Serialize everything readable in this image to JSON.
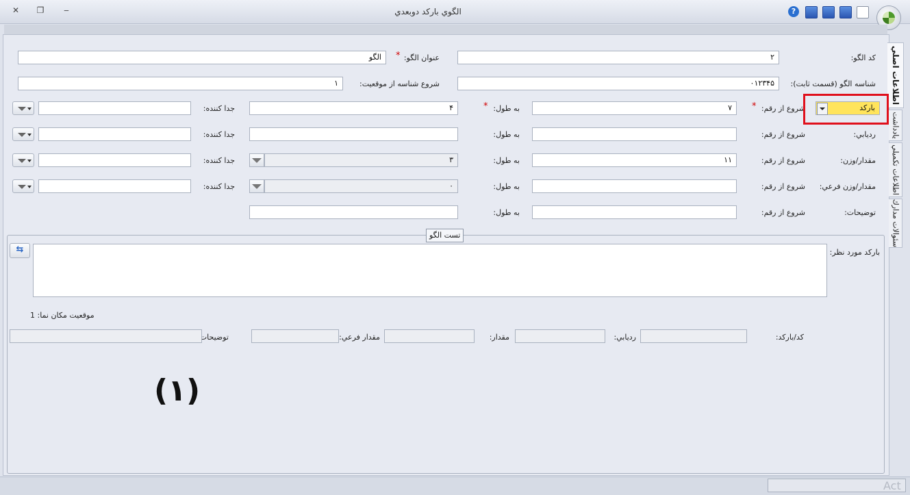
{
  "window": {
    "title": "الگوي بارکد دوبعدي",
    "close_glyph": "✕",
    "restore_glyph": "❐",
    "minimize_glyph": "‒"
  },
  "toolbar": {
    "help_glyph": "?",
    "icons": [
      "help-icon",
      "save-close-icon",
      "save-new-icon",
      "save-icon",
      "new-document-icon"
    ]
  },
  "tabs": {
    "main": "اطلاعات اصلي",
    "notes": "يادداشت",
    "extra": "اطلاعات تكميلي",
    "questions": "سئوالات مدارك"
  },
  "form": {
    "code_label": "كد الگو:",
    "code_value": "۲",
    "title_label": "عنوان الگو:",
    "title_value": "الگو",
    "id_label": "شناسه الگو (قسمت ثابت):",
    "id_value": "۰۱۲۳۴۵",
    "id_start_label": "شروع شناسه از موقعيت:",
    "id_start_value": "۱",
    "type_select": "باركد",
    "start_digit_label": "شروع از رقم:",
    "length_label": "به طول:",
    "separator_label": "جدا كننده:",
    "required_mark": "*",
    "rows": [
      {
        "name": "barcode",
        "label": "",
        "start": "۷",
        "length": "۴",
        "separator": ""
      },
      {
        "name": "tracking",
        "label": "رديابي:",
        "start": "",
        "length": "",
        "separator": ""
      },
      {
        "name": "amount",
        "label": "مقدار/وزن:",
        "start": "۱۱",
        "length": "۳",
        "separator": ""
      },
      {
        "name": "sub-amount",
        "label": "مقدار/وزن فرعي:",
        "start": "",
        "length": "۰",
        "separator": ""
      },
      {
        "name": "description",
        "label": "توضيحات:",
        "start": "",
        "length": ""
      }
    ]
  },
  "test": {
    "group_title": "تست الگو",
    "barcode_label": "باركد مورد نظر:",
    "position_label": "موقعيت مكان نما: 1",
    "refresh_glyph": "⇆",
    "code_barcode_label": "كد/باركد:",
    "tracking_label": "رديابي:",
    "amount_label": "مقدار:",
    "sub_amount_label": "مقدار فرعي:",
    "description_label": "توضيحات:"
  },
  "annotation": "(۱)",
  "status": {
    "watermark": "Act"
  },
  "colors": {
    "highlight": "#e0101c",
    "select_bg": "#ffe45c"
  }
}
